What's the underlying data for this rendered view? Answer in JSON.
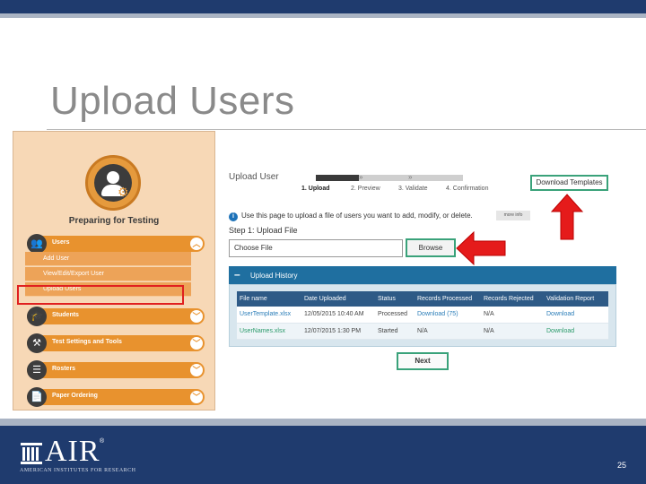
{
  "slide": {
    "title": "Upload Users",
    "page_number": "25"
  },
  "sidebar": {
    "panel_title": "Preparing for Testing",
    "menu": [
      {
        "label": "Users"
      },
      {
        "label": "Students"
      },
      {
        "label": "Test Settings and Tools"
      },
      {
        "label": "Rosters"
      },
      {
        "label": "Paper Ordering"
      }
    ],
    "users_submenu": [
      {
        "label": "Add User"
      },
      {
        "label": "View/Edit/Export User"
      },
      {
        "label": "Upload Users"
      }
    ]
  },
  "upload": {
    "heading": "Upload User",
    "steps": [
      {
        "label": "1. Upload"
      },
      {
        "label": "2. Preview"
      },
      {
        "label": "3. Validate"
      },
      {
        "label": "4. Confirmation"
      }
    ],
    "download_templates": "Download Templates",
    "info_text": "Use this page to upload a file of users you want to add, modify, or delete.",
    "more_info": "more info",
    "step1_label": "Step 1: Upload File",
    "file_input_value": "Choose File",
    "browse_label": "Browse",
    "history_label": "Upload History",
    "history_toggle": "–",
    "next_label": "Next",
    "table": {
      "headers": [
        "File name",
        "Date Uploaded",
        "Status",
        "Records Processed",
        "Records Rejected",
        "Validation Report"
      ],
      "rows": [
        [
          "UserTemplate.xlsx",
          "12/05/2015 10:40 AM",
          "Processed",
          "Download (75)",
          "N/A",
          "Download"
        ],
        [
          "UserNames.xlsx",
          "12/07/2015 1:30 PM",
          "Started",
          "N/A",
          "N/A",
          "Download"
        ]
      ]
    }
  },
  "footer": {
    "logo": "AIR",
    "logo_reg": "®",
    "logo_sub": "AMERICAN INSTITUTES FOR RESEARCH"
  },
  "colors": {
    "header_bar": "#1f3b6e",
    "sidebar_bg": "#f7d8b6",
    "menu_orange": "#e8922e",
    "accent_green": "#3aa27a",
    "history_blue": "#1f6fa0",
    "highlight_red": "#e02020"
  },
  "icons": {
    "avatar": "user-gear-icon",
    "info": "info-icon",
    "chevron": "chevron-icon"
  }
}
